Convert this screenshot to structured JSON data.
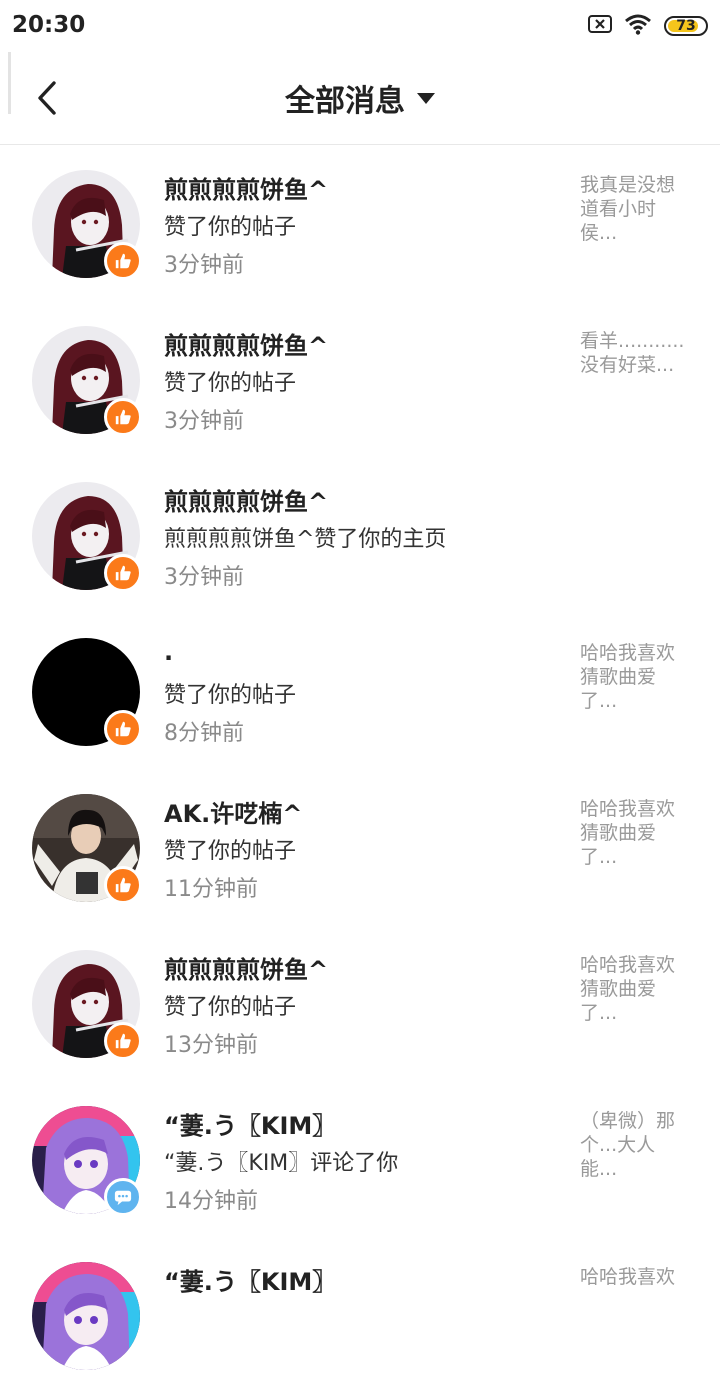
{
  "status_bar": {
    "time": "20:30",
    "icons": [
      "sim-blocked-icon",
      "wifi-icon",
      "battery-icon"
    ],
    "battery": "73",
    "battery_color": "#f5c51c"
  },
  "header": {
    "back_icon": "chevron-left-icon",
    "title": "全部消息",
    "dropdown_icon": "caret-down-icon"
  },
  "colors": {
    "like_badge": "#fb7a1a",
    "comment_badge": "#5fb4ef"
  },
  "notifications": [
    {
      "name": "煎煎煎煎饼鱼^",
      "action": "赞了你的帖子",
      "time": "3分钟前",
      "avatar": "anime-girl-red-hair",
      "badge": "thumbs-up-icon",
      "preview_lines": [
        "我真是没想",
        "道看小时",
        "侯..."
      ]
    },
    {
      "name": "煎煎煎煎饼鱼^",
      "action": "赞了你的帖子",
      "time": "3分钟前",
      "avatar": "anime-girl-red-hair",
      "badge": "thumbs-up-icon",
      "preview_lines": [
        "看羊...........",
        "没有好菜..."
      ]
    },
    {
      "name": "煎煎煎煎饼鱼^",
      "action": "煎煎煎煎饼鱼^赞了你的主页",
      "time": "3分钟前",
      "avatar": "anime-girl-red-hair",
      "badge": "thumbs-up-icon",
      "preview_lines": []
    },
    {
      "name": ".",
      "action": "赞了你的帖子",
      "time": "8分钟前",
      "avatar": "black-circle",
      "badge": "thumbs-up-icon",
      "preview_lines": [
        "哈哈我喜欢",
        "猜歌曲爱",
        "了..."
      ]
    },
    {
      "name": "AK.许呓楠^",
      "action": "赞了你的帖子",
      "time": "11分钟前",
      "avatar": "person-photo",
      "badge": "thumbs-up-icon",
      "preview_lines": [
        "哈哈我喜欢",
        "猜歌曲爱",
        "了..."
      ]
    },
    {
      "name": "煎煎煎煎饼鱼^",
      "action": "赞了你的帖子",
      "time": "13分钟前",
      "avatar": "anime-girl-red-hair",
      "badge": "thumbs-up-icon",
      "preview_lines": [
        "哈哈我喜欢",
        "猜歌曲爱",
        "了..."
      ]
    },
    {
      "name": "“萋.う〖KIM〗",
      "action": "“萋.う〖KIM〗评论了你",
      "time": "14分钟前",
      "avatar": "anime-girl-purple-hair",
      "badge": "comment-icon",
      "preview_lines": [
        "（卑微）那",
        "个...大人",
        "能..."
      ]
    },
    {
      "name": "“萋.う〖KIM〗",
      "action": "",
      "time": "",
      "avatar": "anime-girl-purple-hair",
      "badge": "",
      "preview_lines": [
        "哈哈我喜欢"
      ]
    }
  ]
}
